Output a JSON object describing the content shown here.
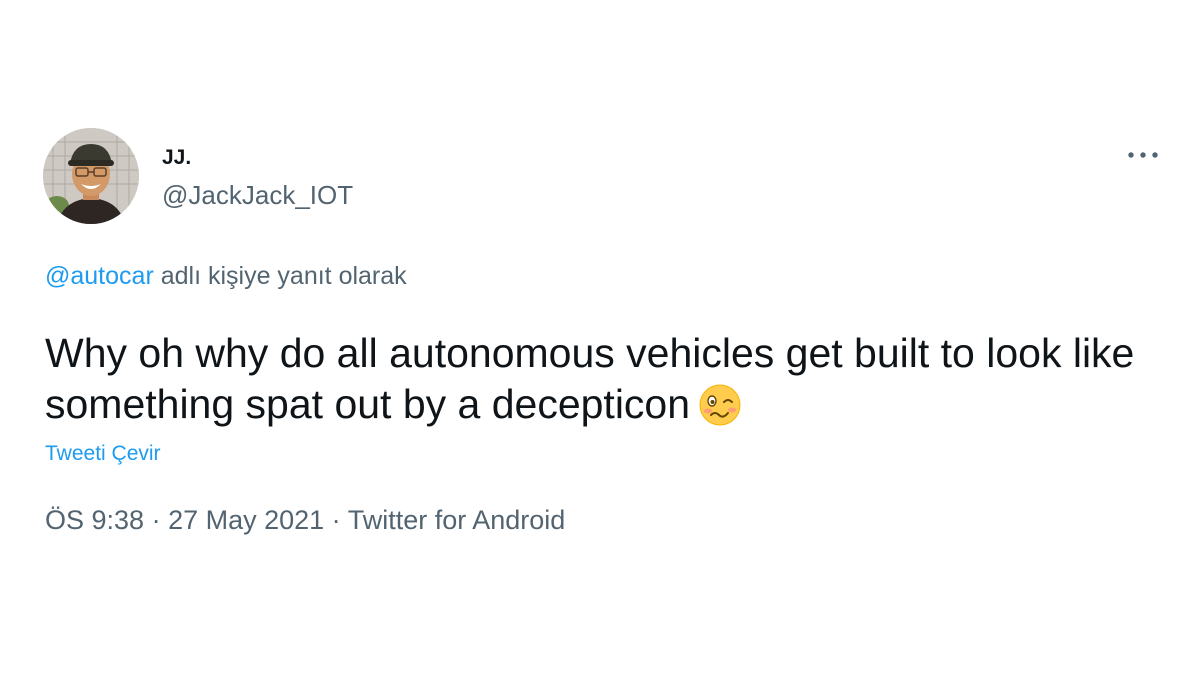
{
  "author": {
    "name": "JJ.",
    "handle": "@JackJack_IOT",
    "avatar_icon": "profile-photo"
  },
  "more_icon": "more-horizontal-icon",
  "reply": {
    "mention": "@autocar",
    "suffix": " adlı kişiye yanıt olarak"
  },
  "tweet": {
    "text": "Why oh why do all autonomous vehicles get built to look like something spat out by a decepticon",
    "emoji_icon": "woozy-face-emoji"
  },
  "translate_label": "Tweeti Çevir",
  "meta": {
    "time": "ÖS 9:38",
    "separator1": " · ",
    "date": "27 May 2021",
    "separator2": " · ",
    "source": "Twitter for Android"
  },
  "colors": {
    "link": "#1d9bf0",
    "secondary_text": "#536471",
    "primary_text": "#0f1419"
  }
}
